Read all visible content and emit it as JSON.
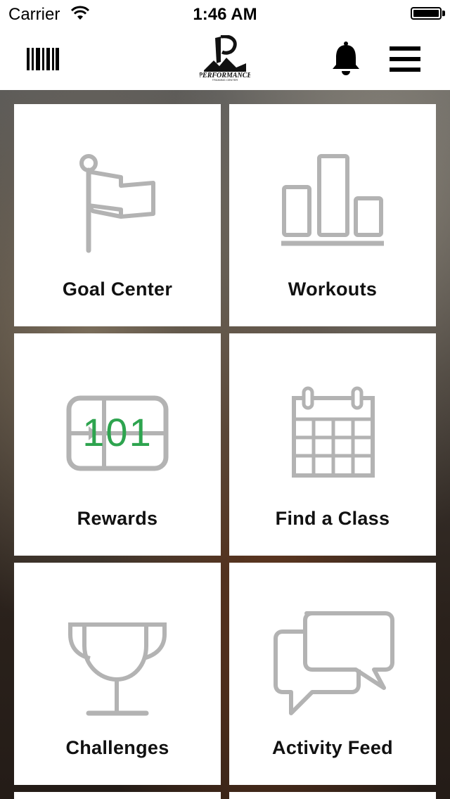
{
  "status_bar": {
    "carrier": "Carrier",
    "time": "1:46 AM"
  },
  "nav": {
    "logo_text": "PERFORMANCE",
    "logo_subtext": "TRAINING CENTER",
    "icons": [
      "barcode-icon",
      "logo",
      "bell-icon",
      "hamburger-menu-icon"
    ]
  },
  "tiles": [
    {
      "label": "Goal Center",
      "icon": "flag-icon"
    },
    {
      "label": "Workouts",
      "icon": "bar-chart-icon"
    },
    {
      "label": "Rewards",
      "icon": "rewards-card-icon",
      "value": "101"
    },
    {
      "label": "Find a Class",
      "icon": "calendar-icon"
    },
    {
      "label": "Challenges",
      "icon": "trophy-icon"
    },
    {
      "label": "Activity Feed",
      "icon": "chat-bubbles-icon"
    }
  ],
  "colors": {
    "icon_gray": "#b3b3b3",
    "rewards_green": "#2ea44f",
    "label_text": "#111111"
  }
}
